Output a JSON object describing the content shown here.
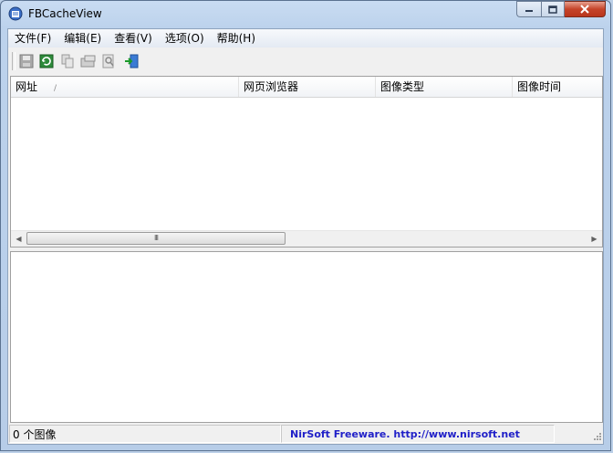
{
  "window": {
    "title": "FBCacheView"
  },
  "menu": [
    "文件(F)",
    "编辑(E)",
    "查看(V)",
    "选项(O)",
    "帮助(H)"
  ],
  "toolbar": {
    "buttons": [
      "save-icon",
      "refresh-icon",
      "copy-icon",
      "properties-icon",
      "find-icon",
      "exit-icon"
    ]
  },
  "list": {
    "columns": [
      "网址",
      "网页浏览器",
      "图像类型",
      "图像时间"
    ],
    "sort_indicator": "/",
    "scroll_grip": "III"
  },
  "status": {
    "count": "0 个图像",
    "link": "NirSoft Freeware.  http://www.nirsoft.net"
  }
}
